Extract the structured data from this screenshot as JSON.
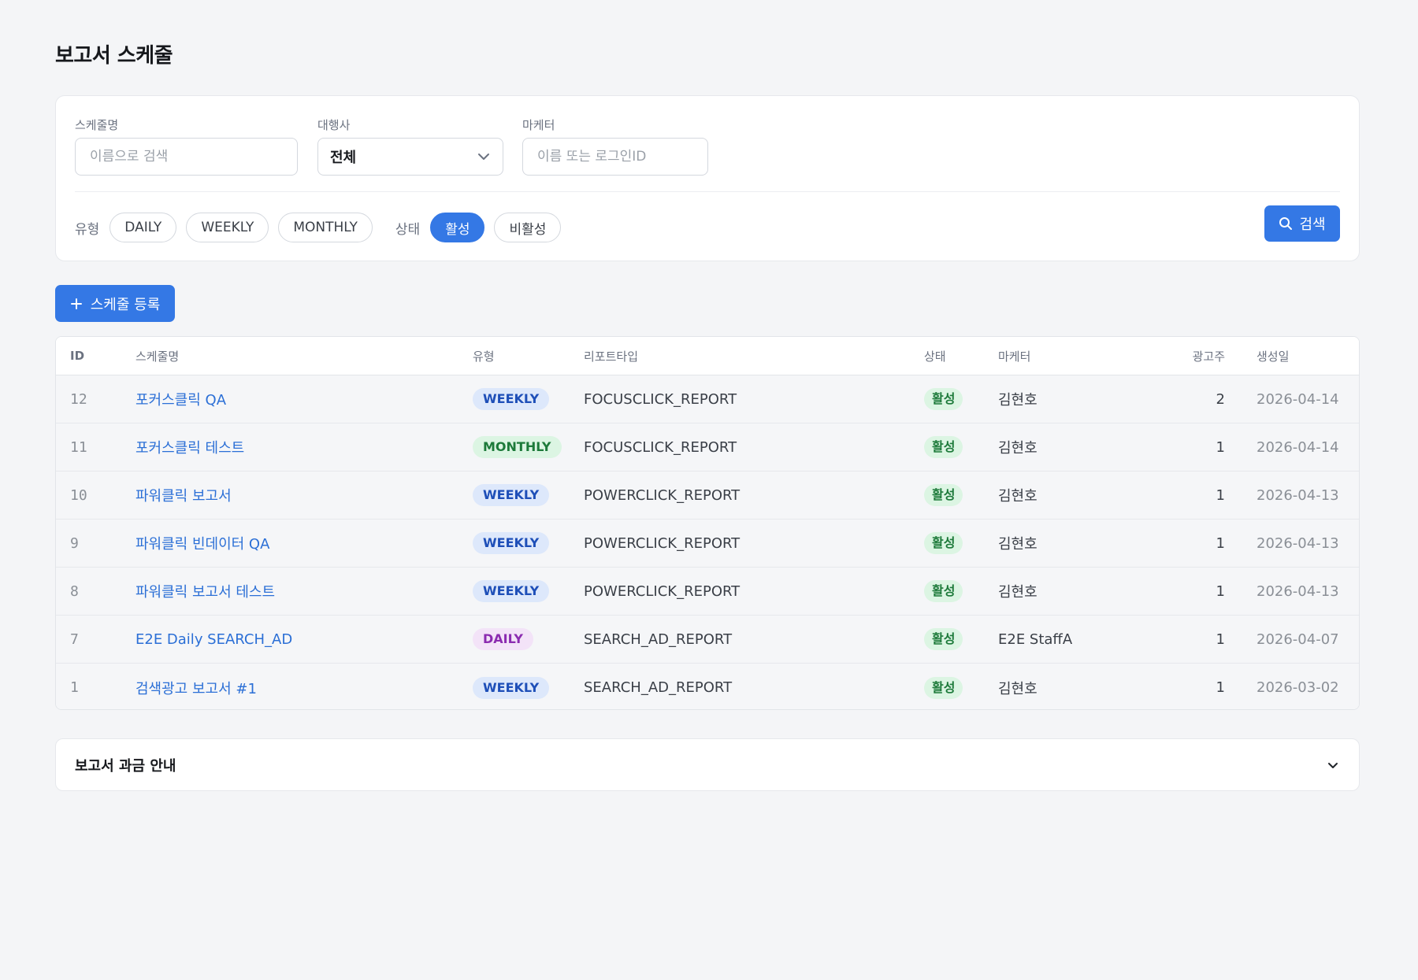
{
  "page": {
    "title": "보고서 스케줄"
  },
  "filters": {
    "schedule_name": {
      "label": "스케줄명",
      "placeholder": "이름으로 검색",
      "value": ""
    },
    "agency": {
      "label": "대행사",
      "value": "전체"
    },
    "marketer": {
      "label": "마케터",
      "placeholder": "이름 또는 로그인ID",
      "value": ""
    },
    "type": {
      "label": "유형",
      "options": [
        "DAILY",
        "WEEKLY",
        "MONTHLY"
      ]
    },
    "status": {
      "label": "상태",
      "options": [
        "활성",
        "비활성"
      ],
      "selected": "활성"
    },
    "search_button": "검색"
  },
  "actions": {
    "add_schedule": "스케줄 등록"
  },
  "table": {
    "columns": [
      "ID",
      "스케줄명",
      "유형",
      "리포트타입",
      "상태",
      "마케터",
      "광고주",
      "생성일"
    ],
    "rows": [
      {
        "id": "12",
        "name": "포커스클릭 QA",
        "type": "WEEKLY",
        "report_type": "FOCUSCLICK_REPORT",
        "status": "활성",
        "marketer": "김현호",
        "advertisers": "2",
        "created": "2026-04-14"
      },
      {
        "id": "11",
        "name": "포커스클릭 테스트",
        "type": "MONTHLY",
        "report_type": "FOCUSCLICK_REPORT",
        "status": "활성",
        "marketer": "김현호",
        "advertisers": "1",
        "created": "2026-04-14"
      },
      {
        "id": "10",
        "name": "파워클릭 보고서",
        "type": "WEEKLY",
        "report_type": "POWERCLICK_REPORT",
        "status": "활성",
        "marketer": "김현호",
        "advertisers": "1",
        "created": "2026-04-13"
      },
      {
        "id": "9",
        "name": "파워클릭 빈데이터 QA",
        "type": "WEEKLY",
        "report_type": "POWERCLICK_REPORT",
        "status": "활성",
        "marketer": "김현호",
        "advertisers": "1",
        "created": "2026-04-13"
      },
      {
        "id": "8",
        "name": "파워클릭 보고서 테스트",
        "type": "WEEKLY",
        "report_type": "POWERCLICK_REPORT",
        "status": "활성",
        "marketer": "김현호",
        "advertisers": "1",
        "created": "2026-04-13"
      },
      {
        "id": "7",
        "name": "E2E Daily SEARCH_AD",
        "type": "DAILY",
        "report_type": "SEARCH_AD_REPORT",
        "status": "활성",
        "marketer": "E2E StaffA",
        "advertisers": "1",
        "created": "2026-04-07"
      },
      {
        "id": "1",
        "name": "검색광고 보고서 #1",
        "type": "WEEKLY",
        "report_type": "SEARCH_AD_REPORT",
        "status": "활성",
        "marketer": "김현호",
        "advertisers": "1",
        "created": "2026-03-02"
      }
    ]
  },
  "billing_accordion": {
    "title": "보고서 과금 안내",
    "expanded": false
  },
  "colors": {
    "primary": "#3478e5",
    "link": "#2b6fd6",
    "active_green": "#1d7a3a"
  }
}
